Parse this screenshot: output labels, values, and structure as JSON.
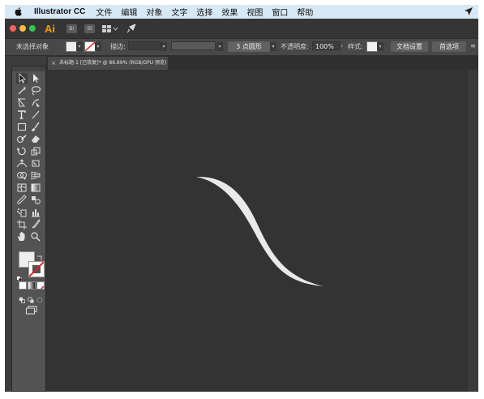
{
  "menubar": {
    "app_name": "Illustrator CC",
    "items": [
      "文件",
      "编辑",
      "对象",
      "文字",
      "选择",
      "效果",
      "视图",
      "窗口",
      "帮助"
    ]
  },
  "titlebar": {
    "logo": "Ai",
    "bridge_label": "Br",
    "stock_label": "St"
  },
  "controlbar": {
    "selection_status": "未选择对象",
    "stroke_label": "描边:",
    "stroke_value": "",
    "brush_label": "3 点圆形",
    "opacity_label": "不透明度:",
    "opacity_value": "100%",
    "style_label": "样式:",
    "doc_setup_button": "文档设置",
    "prefs_button": "首选项"
  },
  "document_tab": {
    "close_glyph": "×",
    "title": "未标题-1 [已恢复]* @ 86.89% (RGB/GPU 预览)"
  },
  "colors": {
    "menubar_bg": "#d7e8f6",
    "ai_orange": "#ff9a00",
    "canvas_bg": "#333333",
    "shape_fill": "#e9e9e9",
    "close_dot": "#fc605c",
    "minimize_dot": "#fdbc40",
    "zoom_dot": "#34c84a"
  },
  "toolbar": {
    "tools": [
      "selection-tool",
      "direct-selection-tool",
      "magic-wand-tool",
      "lasso-tool",
      "pen-tool",
      "curvature-tool",
      "type-tool",
      "line-segment-tool",
      "rectangle-tool",
      "paintbrush-tool",
      "shaper-tool",
      "eraser-tool",
      "rotate-tool",
      "scale-tool",
      "width-tool",
      "free-transform-tool",
      "shape-builder-tool",
      "perspective-grid-tool",
      "mesh-tool",
      "gradient-tool",
      "eyedropper-tool",
      "blend-tool",
      "symbol-sprayer-tool",
      "column-graph-tool",
      "artboard-tool",
      "slice-tool",
      "hand-tool",
      "zoom-tool"
    ]
  }
}
